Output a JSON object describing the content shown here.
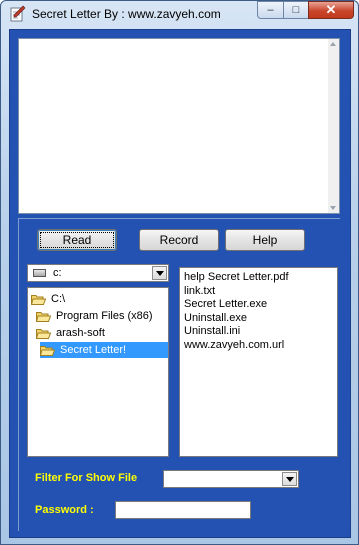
{
  "window": {
    "title": "Secret Letter By : www.zavyeh.com",
    "controls": {
      "minimize": "–",
      "maximize": "□",
      "close": "✕"
    }
  },
  "memo": {
    "value": ""
  },
  "buttons": {
    "read": "Read",
    "record": "Record",
    "help": "Help"
  },
  "drive": {
    "selected": "c:"
  },
  "folders": [
    {
      "label": "C:\\",
      "icon": "folder-open-icon"
    },
    {
      "label": "Program Files (x86)",
      "icon": "folder-open-icon"
    },
    {
      "label": "arash-soft",
      "icon": "folder-open-icon"
    },
    {
      "label": "Secret Letter!",
      "icon": "folder-open-icon",
      "selected": true
    }
  ],
  "files": [
    "help Secret Letter.pdf",
    "link.txt",
    "Secret Letter.exe",
    "Uninstall.exe",
    "Uninstall.ini",
    "www.zavyeh.com.url"
  ],
  "filter": {
    "label": "Filter For Show File",
    "selected": ""
  },
  "password": {
    "label": "Password :",
    "value": ""
  },
  "colors": {
    "client_bg": "#2452b3",
    "label_text": "#ffff00",
    "selection": "#3399ff"
  }
}
